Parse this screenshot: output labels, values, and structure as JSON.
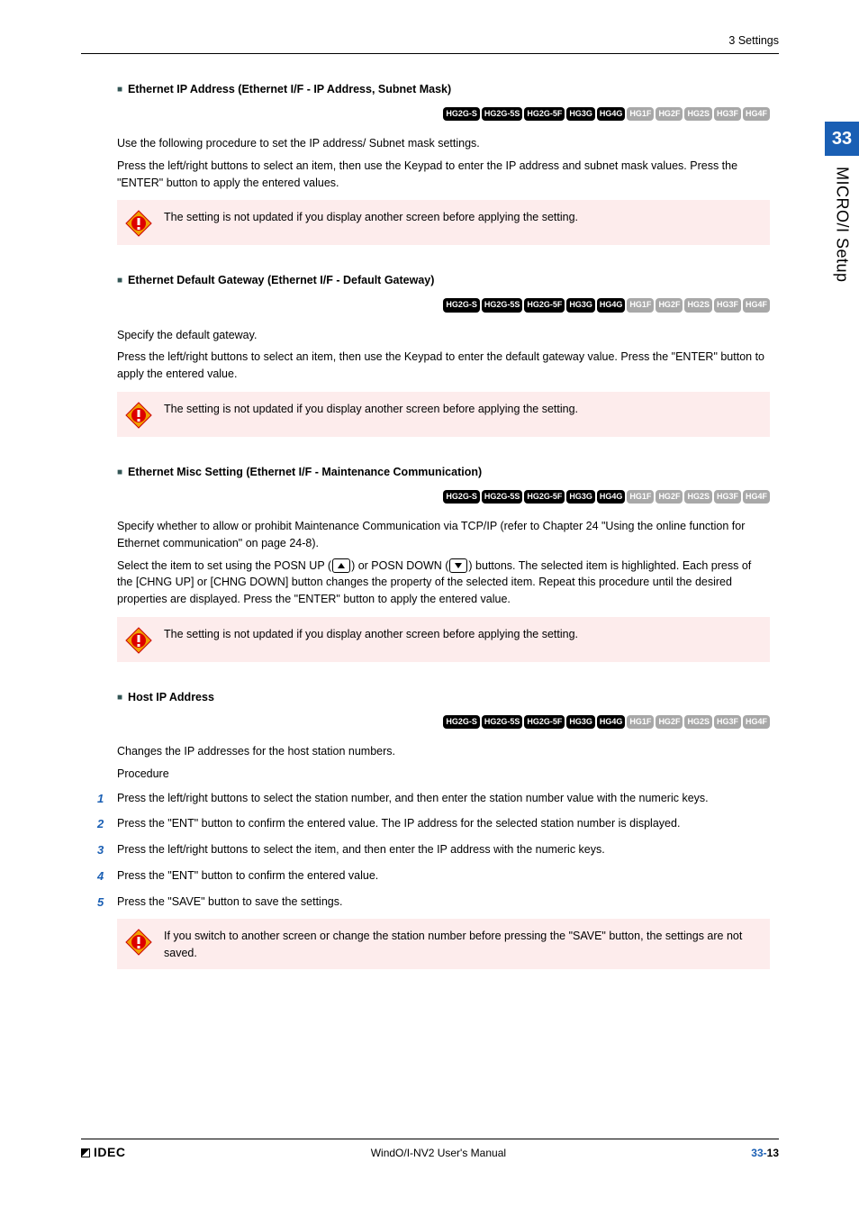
{
  "header": {
    "section_label": "3 Settings"
  },
  "sidebar": {
    "chapter_number": "33",
    "chapter_title": "MICRO/I Setup"
  },
  "models": {
    "all_on": [
      {
        "label": "HG2G-S",
        "on": true
      },
      {
        "label": "HG2G-5S",
        "on": true
      },
      {
        "label": "HG2G-5F",
        "on": true
      },
      {
        "label": "HG3G",
        "on": true
      },
      {
        "label": "HG4G",
        "on": true
      },
      {
        "label": "HG1F",
        "on": false
      },
      {
        "label": "HG2F",
        "on": false
      },
      {
        "label": "HG2S",
        "on": false
      },
      {
        "label": "HG3F",
        "on": false
      },
      {
        "label": "HG4F",
        "on": false
      }
    ]
  },
  "sections": {
    "s1": {
      "title": "Ethernet IP Address (Ethernet I/F - IP Address, Subnet Mask)",
      "p1": "Use the following procedure to set the IP address/ Subnet mask settings.",
      "p2": "Press the left/right buttons to select an item, then use the Keypad to enter the IP address and subnet mask values. Press the \"ENTER\" button to apply the entered values.",
      "note": "The setting is not updated if you display another screen before applying the setting."
    },
    "s2": {
      "title": "Ethernet Default Gateway  (Ethernet I/F - Default Gateway)",
      "p1": "Specify the default gateway.",
      "p2": "Press the left/right buttons to select an item, then use the Keypad to enter the default gateway value. Press the \"ENTER\" button to apply the entered value.",
      "note": "The setting is not updated if you display another screen before applying the setting."
    },
    "s3": {
      "title": "Ethernet Misc Setting (Ethernet I/F - Maintenance Communication)",
      "p1": "Specify whether to allow or prohibit Maintenance Communication via TCP/IP (refer to Chapter 24 \"Using the online function for Ethernet communication\" on page 24-8).",
      "p2a": "Select the item to set using the POSN UP (",
      "p2b": ") or POSN DOWN (",
      "p2c": ") buttons. The selected item is highlighted. Each press of the [CHNG UP] or [CHNG DOWN] button changes the property of the selected item. Repeat this procedure until the desired properties are displayed. Press the \"ENTER\" button to apply the entered value.",
      "note": "The setting is not updated if you display another screen before applying the setting."
    },
    "s4": {
      "title": "Host IP Address",
      "p1": "Changes the IP addresses for the host station numbers.",
      "p2": "Procedure",
      "steps": [
        "Press the left/right buttons to select the station number, and then enter the station number value with the numeric keys.",
        "Press the \"ENT\" button to confirm the entered value. The IP address for the selected station number is displayed.",
        "Press the left/right buttons to select the item, and then enter the IP address with the numeric keys.",
        "Press the \"ENT\" button to confirm the entered value.",
        "Press the \"SAVE\" button to save the settings."
      ],
      "note": "If you switch to another screen or change the station number before pressing the \"SAVE\" button, the settings are not saved."
    }
  },
  "footer": {
    "logo": "IDEC",
    "manual": "WindO/I-NV2 User's Manual",
    "page_chapter": "33-",
    "page_num": "13"
  }
}
